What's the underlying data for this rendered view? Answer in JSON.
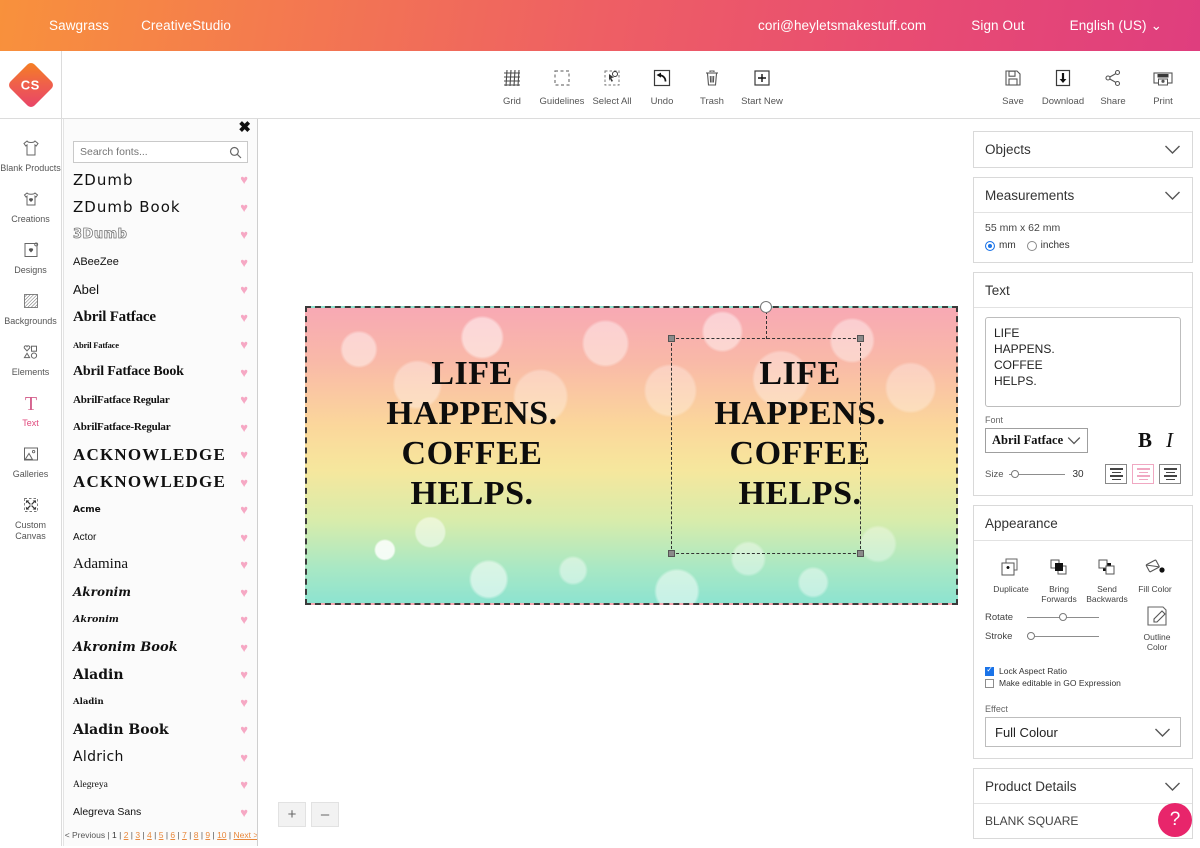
{
  "topbar": {
    "brand": "Sawgrass",
    "app": "CreativeStudio",
    "email": "cori@heyletsmakestuff.com",
    "signout": "Sign Out",
    "language": "English (US)",
    "chevron": "⌄"
  },
  "logo": {
    "text": "CS"
  },
  "toolbar": {
    "center": [
      {
        "label": "Grid",
        "icon": "grid-icon"
      },
      {
        "label": "Guidelines",
        "icon": "guidelines-icon"
      },
      {
        "label": "Select All",
        "icon": "select-all-icon"
      },
      {
        "label": "Undo",
        "icon": "undo-icon"
      },
      {
        "label": "Trash",
        "icon": "trash-icon"
      },
      {
        "label": "Start New",
        "icon": "plus-icon"
      }
    ],
    "right": [
      {
        "label": "Save",
        "icon": "floppy-disk-icon"
      },
      {
        "label": "Download",
        "icon": "download-icon"
      },
      {
        "label": "Share",
        "icon": "share-icon"
      },
      {
        "label": "Print",
        "icon": "printer-icon"
      }
    ]
  },
  "rail": [
    {
      "label": "Blank Products",
      "icon": "tshirt-icon",
      "active": false
    },
    {
      "label": "Creations",
      "icon": "tshirt-design-icon",
      "active": false
    },
    {
      "label": "Designs",
      "icon": "design-frame-icon",
      "active": false
    },
    {
      "label": "Backgrounds",
      "icon": "hatch-pattern-icon",
      "active": false
    },
    {
      "label": "Elements",
      "icon": "shapes-icon",
      "active": false
    },
    {
      "label": "Text",
      "icon": "text-T-icon",
      "active": true
    },
    {
      "label": "Galleries",
      "icon": "picture-icon",
      "active": false
    },
    {
      "label": "Custom Canvas",
      "icon": "resize-arrows-icon",
      "active": false
    }
  ],
  "fontpanel": {
    "close": "✖",
    "search_placeholder": "Search fonts...",
    "search_value": "",
    "search_icon": "search-icon",
    "heart_glyph": "♥",
    "fonts": [
      {
        "name": "ZDumb",
        "style": "zdumb",
        "size": 15
      },
      {
        "name": "ZDumb Book",
        "style": "zdumb",
        "size": 15
      },
      {
        "name": "3Dumb",
        "style": "outline",
        "size": 13
      },
      {
        "name": "ABeeZee",
        "style": "sans",
        "size": 11
      },
      {
        "name": "Abel",
        "style": "sans-light",
        "size": 13
      },
      {
        "name": "Abril Fatface",
        "style": "fat",
        "size": 15
      },
      {
        "name": "Abril Fatface",
        "style": "fat",
        "size": 8.5
      },
      {
        "name": "Abril Fatface Book",
        "style": "fat",
        "size": 14
      },
      {
        "name": "AbrilFatface Regular",
        "style": "fat",
        "size": 11
      },
      {
        "name": "AbrilFatface-Regular",
        "style": "fat",
        "size": 11
      },
      {
        "name": "ACKNOWLEDGE",
        "style": "wide",
        "size": 17
      },
      {
        "name": "ACKNOWLEDGE",
        "style": "wide",
        "size": 17
      },
      {
        "name": "Acme",
        "style": "acme",
        "size": 9
      },
      {
        "name": "Actor",
        "style": "sans",
        "size": 10
      },
      {
        "name": "Adamina",
        "style": "serif",
        "size": 15
      },
      {
        "name": "Akronim",
        "style": "deco",
        "size": 12
      },
      {
        "name": "Akronim",
        "style": "deco",
        "size": 9.5
      },
      {
        "name": "Akronim Book",
        "style": "deco",
        "size": 13
      },
      {
        "name": "Aladin",
        "style": "aladin",
        "size": 14
      },
      {
        "name": "Aladin",
        "style": "aladin",
        "size": 8.5
      },
      {
        "name": "Aladin Book",
        "style": "aladin",
        "size": 14
      },
      {
        "name": "Aldrich",
        "style": "aldrich",
        "size": 14
      },
      {
        "name": "Alegreya",
        "style": "serif",
        "size": 9.5
      },
      {
        "name": "Alegreva Sans",
        "style": "sans",
        "size": 10.5
      }
    ],
    "pager": {
      "previous": "< Previous",
      "pages": [
        "1",
        "2",
        "3",
        "4",
        "5",
        "6",
        "7",
        "8",
        "9",
        "10"
      ],
      "current": "1",
      "next": "Next >",
      "separator": " | "
    }
  },
  "canvas": {
    "design_text": "LIFE\nHAPPENS.\nCOFFEE\nHELPS.",
    "object_a_text": "LIFE HAPPENS. COFFEE HELPS.",
    "object_b_text": "LIFE HAPPENS. COFFEE HELPS.",
    "zoom_in": "+",
    "zoom_out": "–",
    "background_colors": [
      "#f8a9b4",
      "#fbd79b",
      "#f6e79d",
      "#a9e8c4",
      "#8de3d0"
    ]
  },
  "rightpanel": {
    "objects_title": "Objects",
    "measurements_title": "Measurements",
    "dimensions": "55 mm x 62 mm",
    "unit_mm": "mm",
    "unit_inches": "inches",
    "unit_selected": "mm",
    "text_title": "Text",
    "text_value": "LIFE\nHAPPENS.\nCOFFEE\nHELPS.",
    "font_label": "Font",
    "font_value": "Abril Fatface",
    "bold": "B",
    "italic": "I",
    "size_label": "Size",
    "size_value": "30",
    "align_selected": "center",
    "appearance_title": "Appearance",
    "appearance_items": [
      {
        "label": "Duplicate",
        "icon": "duplicate-icon"
      },
      {
        "label": "Bring Forwards",
        "icon": "bring-forwards-icon"
      },
      {
        "label": "Send Backwards",
        "icon": "send-backwards-icon"
      },
      {
        "label": "Fill Color",
        "icon": "fill-color-icon"
      }
    ],
    "rotate_label": "Rotate",
    "stroke_label": "Stroke",
    "outline_color_label": "Outline Color",
    "lock_aspect_label": "Lock Aspect Ratio",
    "lock_aspect_checked": true,
    "go_expression_label": "Make editable in GO Expression",
    "go_expression_checked": false,
    "effect_label": "Effect",
    "effect_value": "Full Colour",
    "product_details_title": "Product Details",
    "product_name": "BLANK SQUARE",
    "chevron": "⌄"
  },
  "help": {
    "glyph": "?"
  }
}
